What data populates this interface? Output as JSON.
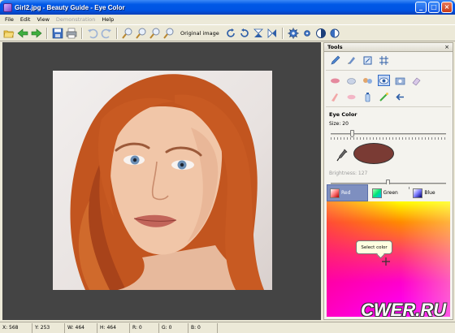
{
  "window": {
    "title": "Girl2.jpg - Beauty Guide - Eye Color",
    "buttons": {
      "minimize": "_",
      "maximize": "□",
      "close": "×"
    }
  },
  "menu": {
    "items": [
      "File",
      "Edit",
      "View",
      "Demonstration",
      "Help"
    ]
  },
  "toolbar": {
    "original_image_label": "Original image"
  },
  "tools_panel": {
    "title": "Tools",
    "close": "×",
    "section_title": "Eye Color",
    "size_label": "Size: 20",
    "size_value": 20,
    "brightness_label": "Brightness: 127",
    "brightness_value": 127,
    "selected_color": "#7a3b34",
    "tabs": [
      "Red",
      "Green",
      "Blue"
    ],
    "tooltip": "Select color"
  },
  "status": {
    "x": "X: 568",
    "y": "Y: 253",
    "w": "W: 464",
    "h": "H: 464",
    "r": "R: 0",
    "g": "G: 0",
    "b": "B: 0"
  },
  "watermark": "CWER.RU",
  "colors": {
    "accent": "#0054e3",
    "canvas": "#444444",
    "active_tab": "#7e8fc0"
  }
}
